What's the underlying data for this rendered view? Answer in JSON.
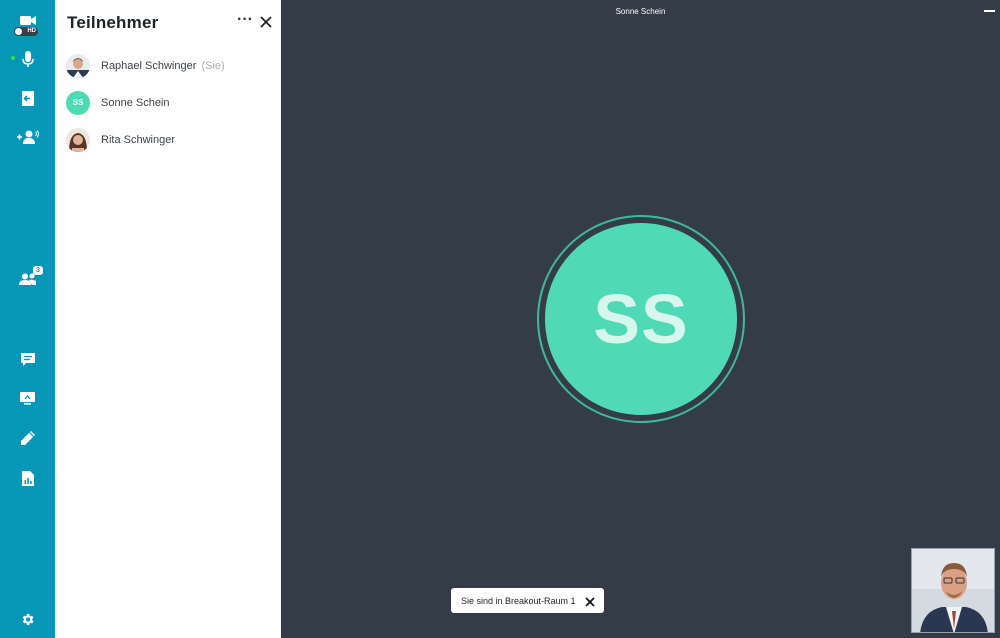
{
  "toolbar": {
    "hd_label": "HD",
    "participants_count": "3",
    "items": [
      {
        "icon": "video-camera-icon"
      },
      {
        "icon": "microphone-icon"
      },
      {
        "icon": "leave-room-icon"
      },
      {
        "icon": "add-person-icon"
      },
      {
        "icon": "participants-icon"
      },
      {
        "icon": "chat-icon"
      },
      {
        "icon": "screen-share-icon"
      },
      {
        "icon": "whiteboard-pen-icon"
      },
      {
        "icon": "document-report-icon"
      },
      {
        "icon": "settings-gear-icon"
      }
    ]
  },
  "panel": {
    "title": "Teilnehmer",
    "more_label": "···",
    "participants": [
      {
        "name": "Raphael Schwinger",
        "suffix": "(Sie)"
      },
      {
        "name": "Sonne Schein",
        "initials": "SS"
      },
      {
        "name": "Rita Schwinger"
      }
    ]
  },
  "stage": {
    "title": "Sonne Schein",
    "avatar_initials": "SS",
    "toast": "Sie sind in Breakout-Raum 1"
  },
  "colors": {
    "toolbar": "#0596b8",
    "stage": "#343c48",
    "avatar": "#50d9b6"
  }
}
